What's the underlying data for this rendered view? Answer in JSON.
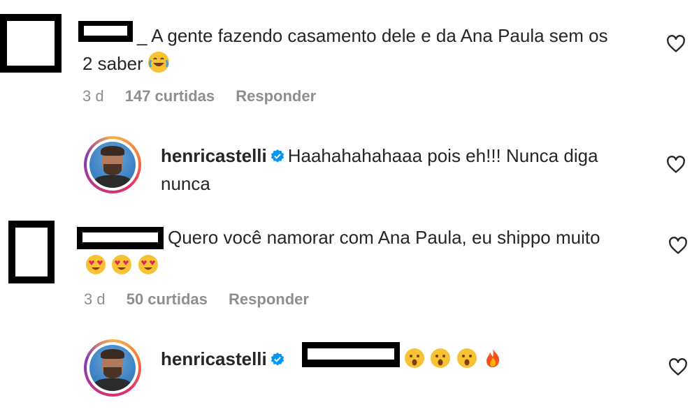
{
  "comments": [
    {
      "text_line1": "_ A gente fazendo casamento dele e da Ana Paula sem os",
      "text_line2": "2 saber",
      "emoji_names": [
        "face-with-tears-of-joy"
      ],
      "time": "3 d",
      "likes": "147 curtidas",
      "reply": "Responder"
    },
    {
      "username": "henricastelli",
      "text_line1": "Haahahahahaaa pois eh!!! Nunca diga",
      "text_line2": "nunca"
    },
    {
      "text_line1": "Quero você namorar com Ana Paula, eu shippo muito",
      "emoji_names": [
        "heart-eyes",
        "heart-eyes",
        "heart-eyes"
      ],
      "time": "3 d",
      "likes": "50 curtidas",
      "reply": "Responder"
    },
    {
      "username": "henricastelli",
      "emoji_names": [
        "astonished",
        "astonished",
        "astonished",
        "fire"
      ]
    }
  ],
  "icons": {
    "like": "heart-outline-icon",
    "verified": "verified-badge-icon"
  },
  "colors": {
    "text": "#262626",
    "meta": "#8e8e8e",
    "verified": "#0095f6",
    "emoji_yellow": "#f7c234"
  }
}
